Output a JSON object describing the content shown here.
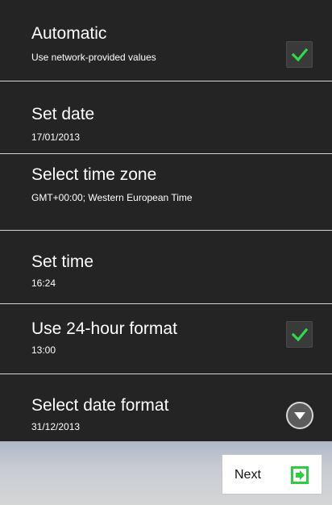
{
  "settings": {
    "automatic": {
      "title": "Automatic",
      "summary": "Use network-provided values",
      "checked": true
    },
    "set_date": {
      "title": "Set date",
      "summary": "17/01/2013"
    },
    "time_zone": {
      "title": "Select time zone",
      "summary": "GMT+00:00; Western European Time"
    },
    "set_time": {
      "title": "Set time",
      "summary": "16:24"
    },
    "hour_format": {
      "title": "Use 24-hour format",
      "summary": "13:00",
      "checked": true
    },
    "date_format": {
      "title": "Select date format",
      "summary": "31/12/2013"
    }
  },
  "footer": {
    "next_label": "Next"
  },
  "colors": {
    "background": "#242424",
    "check_green": "#2fd94a",
    "next_icon_green": "#2ecc40"
  },
  "icons": {
    "checkbox_checked": "check-icon",
    "dropdown": "chevron-down-icon",
    "next": "arrow-right-icon"
  }
}
